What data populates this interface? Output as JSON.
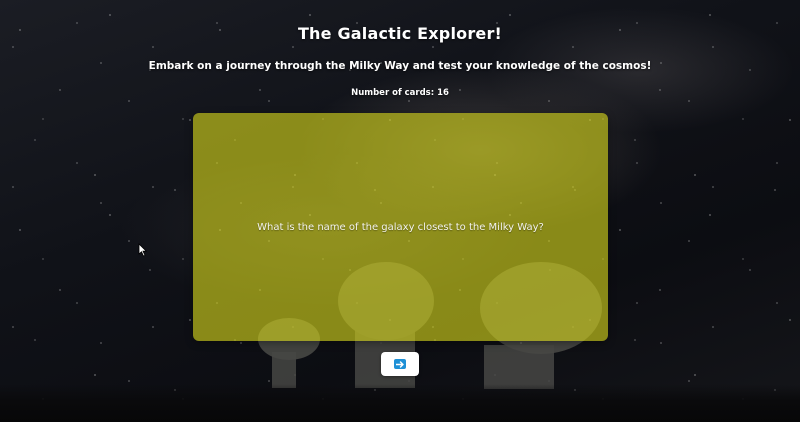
{
  "page": {
    "title": "The Galactic Explorer!",
    "subtitle": "Embark on a journey through the Milky Way and test your knowledge of the cosmos!",
    "card_count_label": "Number of cards: 16"
  },
  "flashcard": {
    "question": "What is the name of the galaxy closest to the Milky Way?",
    "color": "#d6d61c"
  },
  "controls": {
    "next_icon": "right-arrow-icon",
    "next_icon_color": "#1e90d6"
  }
}
